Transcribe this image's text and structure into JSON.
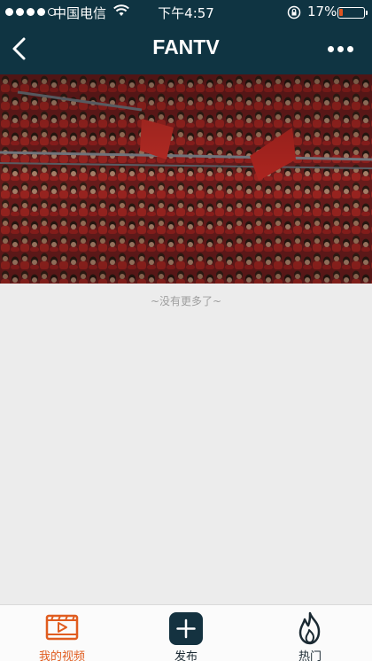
{
  "status_bar": {
    "carrier": "中国电信",
    "time": "下午4:57",
    "battery_percent": "17%",
    "battery_level": 0.17,
    "battery_color": "#e0541f"
  },
  "nav": {
    "title": "FANTV",
    "back_icon": "chevron-left-icon",
    "more_icon": "more-dots-icon",
    "background": "#0f3442"
  },
  "video": {
    "thumbnail_description_icon": "video-thumbnail"
  },
  "list": {
    "end_text": "~没有更多了~"
  },
  "tabbar": {
    "items": [
      {
        "label": "我的视频",
        "icon": "video-play-icon",
        "active": true,
        "color": "#e05d20"
      },
      {
        "label": "发布",
        "icon": "plus-icon",
        "active": false
      },
      {
        "label": "热门",
        "icon": "flame-icon",
        "active": false
      }
    ]
  }
}
